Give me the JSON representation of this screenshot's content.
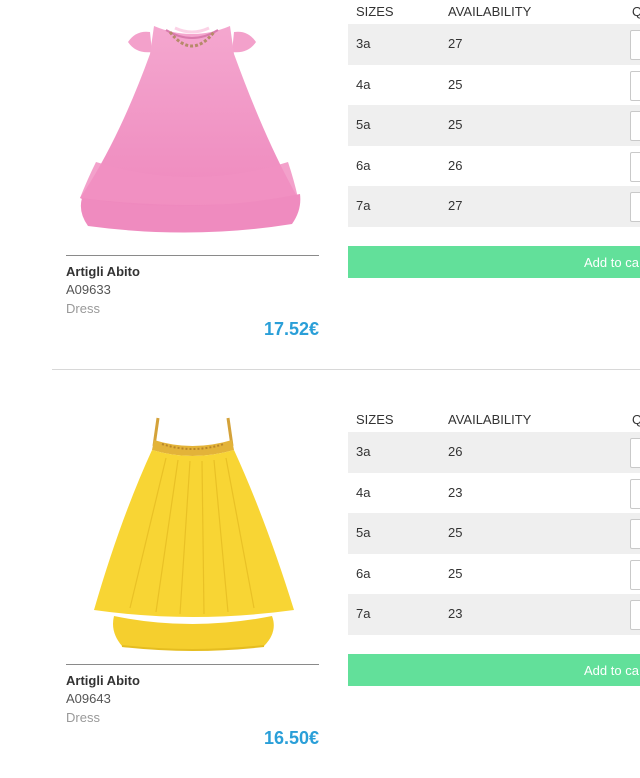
{
  "products": [
    {
      "name": "Artigli Abito",
      "code": "A09633",
      "type": "Dress",
      "price": "17.52€",
      "color": "#f28fc3",
      "table": {
        "headers": {
          "sizes": "SIZES",
          "availability": "AVAILABILITY",
          "qty": "Q"
        },
        "rows": [
          {
            "size": "3a",
            "availability": "27"
          },
          {
            "size": "4a",
            "availability": "25"
          },
          {
            "size": "5a",
            "availability": "25"
          },
          {
            "size": "6a",
            "availability": "26"
          },
          {
            "size": "7a",
            "availability": "27"
          }
        ]
      },
      "add_label": "Add to ca"
    },
    {
      "name": "Artigli Abito",
      "code": "A09643",
      "type": "Dress",
      "price": "16.50€",
      "color": "#f7d438",
      "table": {
        "headers": {
          "sizes": "SIZES",
          "availability": "AVAILABILITY",
          "qty": "Q"
        },
        "rows": [
          {
            "size": "3a",
            "availability": "26"
          },
          {
            "size": "4a",
            "availability": "23"
          },
          {
            "size": "5a",
            "availability": "25"
          },
          {
            "size": "6a",
            "availability": "25"
          },
          {
            "size": "7a",
            "availability": "23"
          }
        ]
      },
      "add_label": "Add to ca"
    }
  ],
  "colors": {
    "accent_price": "#2a9fd8",
    "button_green": "#62e09a",
    "row_shade": "#efefef"
  }
}
